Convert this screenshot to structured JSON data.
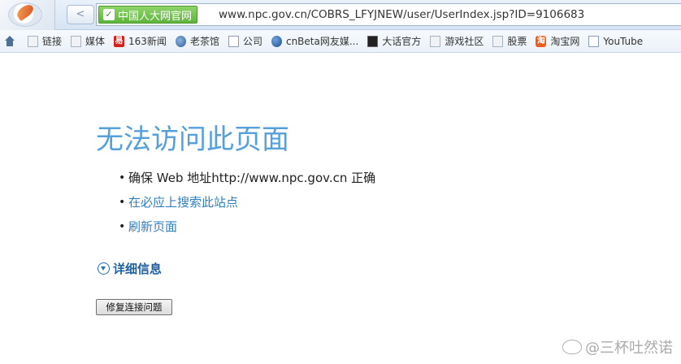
{
  "browser": {
    "back_label": "<",
    "site_badge": "中国人大网官网",
    "url": "www.npc.gov.cn/COBRS_LFYJNEW/user/UserIndex.jsp?ID=9106683",
    "bookmarks": [
      {
        "label": "",
        "icon": "home-icon"
      },
      {
        "label": "链接",
        "icon": "page-icon"
      },
      {
        "label": "媒体",
        "icon": "page-icon"
      },
      {
        "label": "163新闻",
        "icon": "netease-icon"
      },
      {
        "label": "老茶馆",
        "icon": "globe-icon"
      },
      {
        "label": "公司",
        "icon": "page-icon"
      },
      {
        "label": "cnBeta网友媒...",
        "icon": "cnbeta-icon"
      },
      {
        "label": "大话官方",
        "icon": "dahua-icon"
      },
      {
        "label": "游戏社区",
        "icon": "page-icon"
      },
      {
        "label": "股票",
        "icon": "page-icon"
      },
      {
        "label": "淘宝网",
        "icon": "taobao-icon"
      },
      {
        "label": "YouTube",
        "icon": "page-icon"
      }
    ]
  },
  "error": {
    "title": "无法访问此页面",
    "suggestions": [
      {
        "text": "确保 Web 地址http://www.npc.gov.cn 正确",
        "is_link": false
      },
      {
        "text": "在必应上搜索此站点",
        "is_link": true
      },
      {
        "text": "刷新页面",
        "is_link": true
      }
    ],
    "details_label": "详细信息",
    "fix_button": "修复连接问题"
  },
  "watermark": "@三杯吐然诺",
  "colors": {
    "title": "#55a0db",
    "link": "#2f7fc0",
    "badge_green": "#5eb43c"
  }
}
